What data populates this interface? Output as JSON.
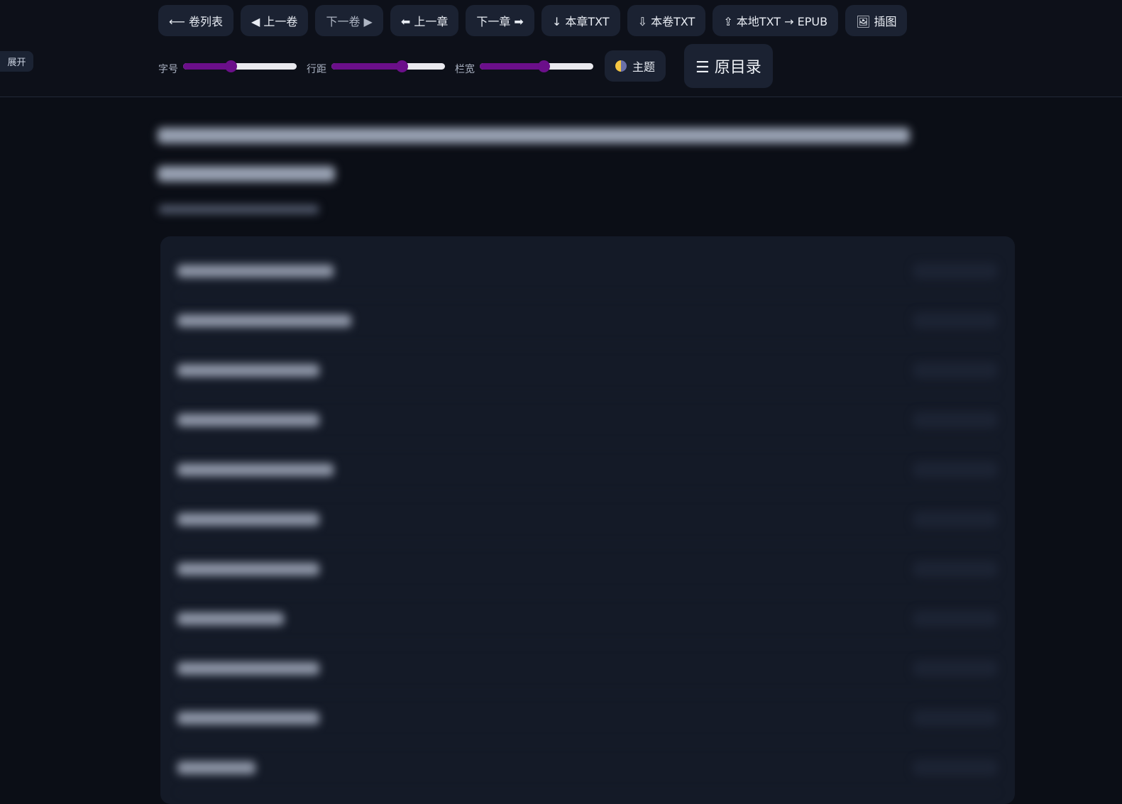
{
  "sidebar": {
    "toggle_label": "展开"
  },
  "toolbar": {
    "buttons": [
      {
        "label": "⟵ 卷列表"
      },
      {
        "label": "◀ 上一卷"
      },
      {
        "label": "下一卷 ▶"
      },
      {
        "label": "⬅ 上一章"
      },
      {
        "label": "下一章 ➡"
      },
      {
        "label": "↓ 本章TXT"
      },
      {
        "label": "⇩ 本卷TXT"
      },
      {
        "label": "⇪ 本地TXT → EPUB"
      },
      {
        "label": "🖼 插图"
      }
    ]
  },
  "controls": {
    "font_size": {
      "label": "字号",
      "value": 0.42
    },
    "line_height": {
      "label": "行距",
      "value": 0.62
    },
    "column_width": {
      "label": "栏宽",
      "value": 0.56
    },
    "theme_label": "主题",
    "toc_label": "☰ 原目录"
  },
  "colors": {
    "background": "#0b0e16",
    "slider_fill": "#6b0f8a",
    "button_bg": "#1b2232"
  }
}
